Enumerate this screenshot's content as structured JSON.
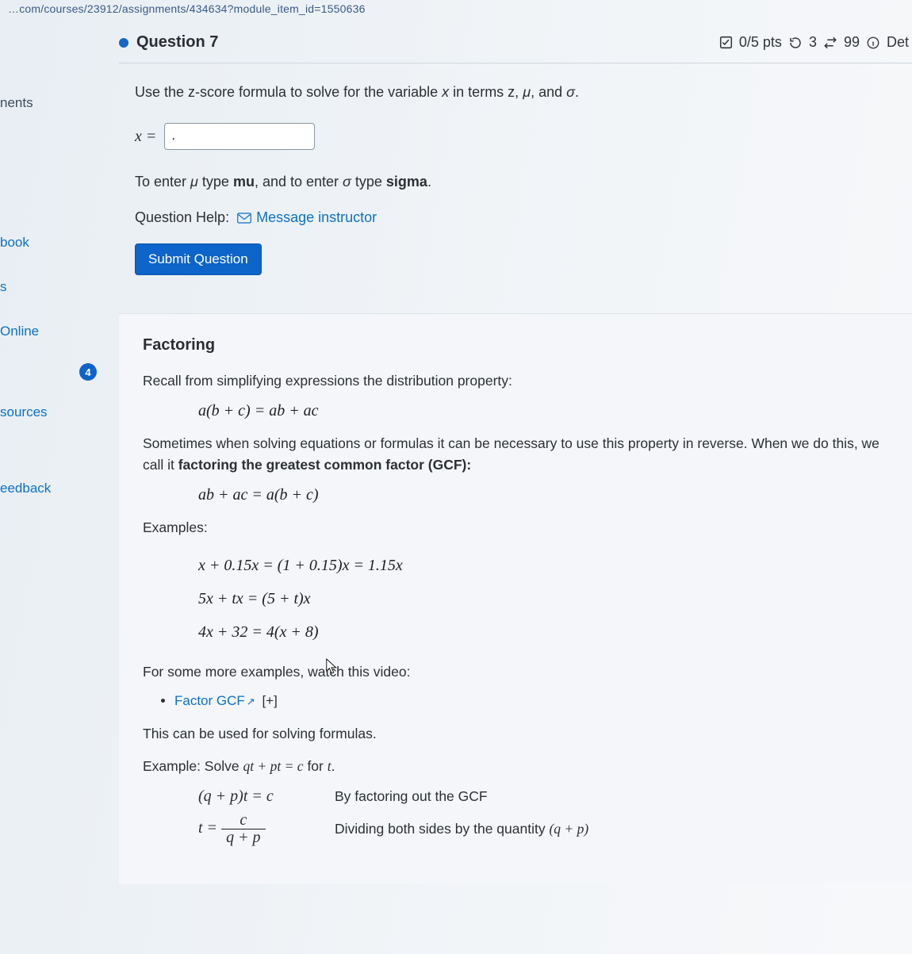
{
  "url_fragment": "…com/courses/23912/assignments/434634?module_item_id=1550636",
  "question": {
    "label": "Question 7",
    "points": "0/5 pts",
    "attempts": "3",
    "time": "99",
    "details": "Det",
    "prompt_pre": "Use the z-score formula to solve for the variable ",
    "prompt_var": "x",
    "prompt_mid": " in terms z, ",
    "mu": "μ",
    "and": ", and ",
    "sigma": "σ",
    "period": ".",
    "x_eq": "x  =",
    "input_value": ".",
    "hint_pre": "To enter ",
    "hint_mu": "μ",
    "hint_mid1": " type ",
    "hint_mu_word": "mu",
    "hint_mid2": ", and to enter ",
    "hint_sigma": "σ",
    "hint_mid3": " type ",
    "hint_sigma_word": "sigma",
    "hint_end": ".",
    "help_label": "Question Help:",
    "help_link": "Message instructor",
    "submit": "Submit Question"
  },
  "sidebar": {
    "items": [
      "nents",
      "book",
      "s",
      "Online",
      "sources",
      "eedback"
    ],
    "badge": "4"
  },
  "section": {
    "title": "Factoring",
    "p1": "Recall from simplifying expressions the distribution property:",
    "eq1": "a(b + c) = ab + ac",
    "p2a": "Sometimes when solving equations or formulas it can be necessary to use this property in reverse.  When we do this, we call it ",
    "p2b": "factoring the greatest common factor (GCF):",
    "eq2": "ab + ac = a(b + c)",
    "examples_label": "Examples:",
    "ex1": "x + 0.15x = (1 + 0.15)x = 1.15x",
    "ex2": "5x + tx = (5 + t)x",
    "ex3": "4x + 32 = 4(x + 8)",
    "p3": "For some more examples, watch this video:",
    "video_link": "Factor GCF",
    "video_ext": "↗",
    "video_plus": "[+]",
    "p4": "This can be used for solving formulas.",
    "p5_pre": "Example:  Solve ",
    "p5_eq": "qt + pt = c",
    "p5_post": "  for ",
    "p5_var": "t",
    "p5_end": ".",
    "step1_lhs": "(q + p)t = c",
    "step1_rhs": "By factoring out the GCF",
    "step2_lhs_t": "t =",
    "step2_num": "c",
    "step2_den": "q + p",
    "step2_rhs_pre": "Dividing both sides by the quantity ",
    "step2_rhs_q": "(q + p)"
  }
}
